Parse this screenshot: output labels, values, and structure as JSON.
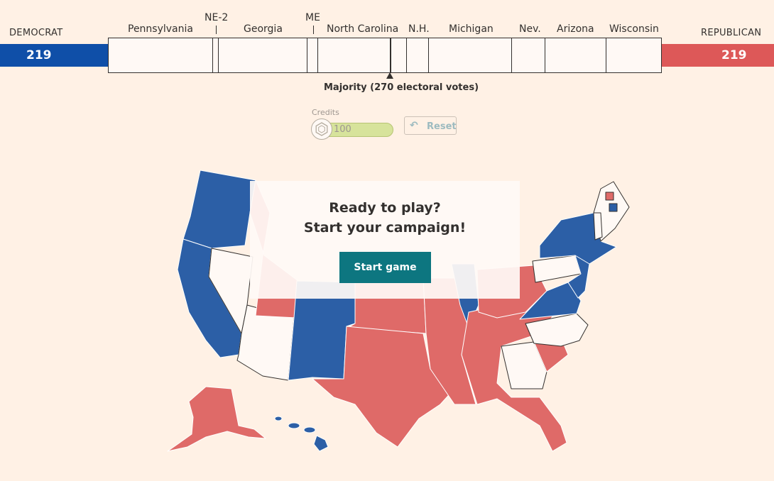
{
  "parties": {
    "democrat": {
      "label": "DEMOCRAT",
      "votes": "219",
      "color": "#0f4fa8"
    },
    "republican": {
      "label": "REPUBLICAN",
      "votes": "219",
      "color": "#dd5858"
    }
  },
  "tracker": {
    "states": [
      {
        "name": "Pennsylvania",
        "short": "Pennsylvania"
      },
      {
        "name": "Nebraska 2nd district",
        "short": "NE-2"
      },
      {
        "name": "Georgia",
        "short": "Georgia"
      },
      {
        "name": "Maine",
        "short": "ME"
      },
      {
        "name": "North Carolina",
        "short": "North Carolina"
      },
      {
        "name": "New Hampshire",
        "short": "N.H."
      },
      {
        "name": "Michigan",
        "short": "Michigan"
      },
      {
        "name": "Nevada",
        "short": "Nev."
      },
      {
        "name": "Arizona",
        "short": "Arizona"
      },
      {
        "name": "Wisconsin",
        "short": "Wisconsin"
      }
    ],
    "majority_label": "Majority (270 electoral votes)"
  },
  "credits": {
    "label": "Credits",
    "value": "100",
    "icon": "hexagon-icon"
  },
  "reset": {
    "label": "Reset",
    "icon": "undo-icon"
  },
  "modal": {
    "line1": "Ready to play?",
    "line2": "Start your campaign!",
    "button": "Start game"
  },
  "colors": {
    "background": "#fff1e5",
    "dem_map": "#2c5fa6",
    "rep_map": "#df6a68",
    "undecided": "#fff9f5",
    "button": "#0d7680"
  }
}
